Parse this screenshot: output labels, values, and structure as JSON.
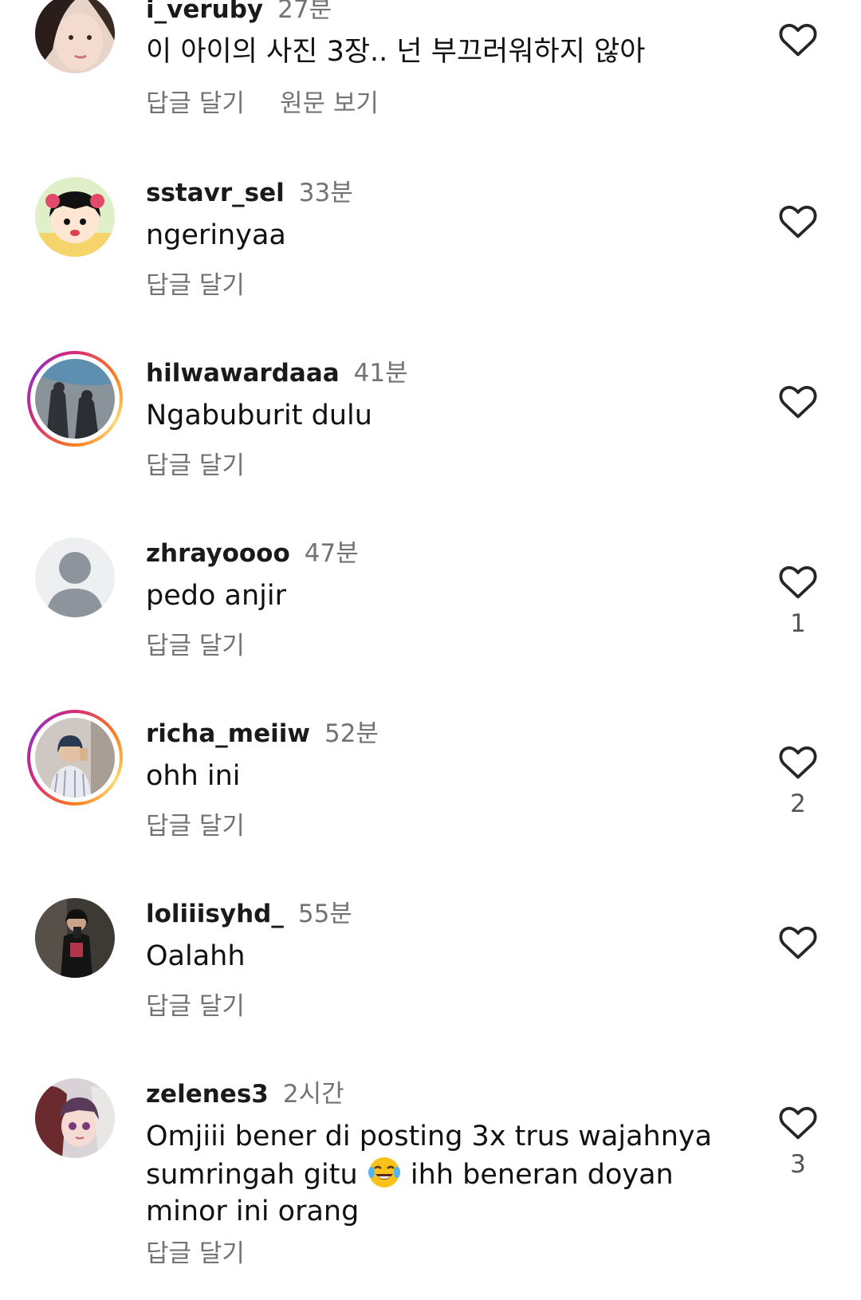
{
  "comments": [
    {
      "username": "i_veruby",
      "time": "27분",
      "text": "이 아이의 사진 3장.. 넌 부끄러워하지 않아",
      "reply": "답글 달기",
      "translate": "원문 보기",
      "likes": ""
    },
    {
      "username": "sstavr_sel",
      "time": "33분",
      "text": "ngerinyaa",
      "reply": "답글 달기",
      "likes": ""
    },
    {
      "username": "hilwawardaaa",
      "time": "41분",
      "text": "Ngabuburit dulu",
      "reply": "답글 달기",
      "likes": ""
    },
    {
      "username": "zhrayoooo",
      "time": "47분",
      "text": "pedo anjir",
      "reply": "답글 달기",
      "likes": "1"
    },
    {
      "username": "richa_meiiw",
      "time": "52분",
      "text": "ohh ini",
      "reply": "답글 달기",
      "likes": "2"
    },
    {
      "username": "loliiisyhd_",
      "time": "55분",
      "text": "Oalahh",
      "reply": "답글 달기",
      "likes": ""
    },
    {
      "username": "zelenes3",
      "time": "2시간",
      "text_part1": "Omjiii bener di posting 3x trus wajahnya sumringah gitu",
      "text_part2": "ihh beneran doyan minor ini orang",
      "reply": "답글 달기",
      "likes": "3"
    }
  ],
  "icons": {
    "like": "heart-outline-icon",
    "emoji": "tears-of-joy-emoji"
  },
  "colors": {
    "muted": "#737373",
    "story_ring_start": "#d62976",
    "story_ring_end": "#fa7e1e"
  }
}
